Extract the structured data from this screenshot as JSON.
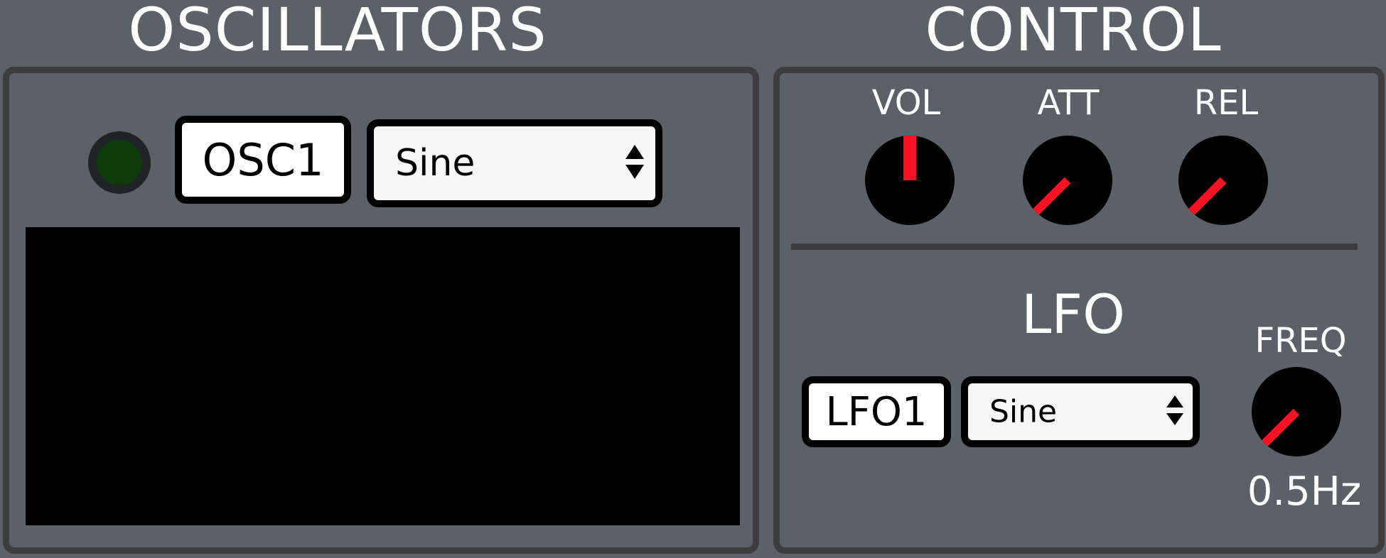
{
  "oscillators": {
    "title": "OSCILLATORS",
    "osc_button_label": "OSC1",
    "waveform_selected": "Sine",
    "led_color": "#0c3b0c"
  },
  "control": {
    "title": "CONTROL",
    "knobs": {
      "vol": {
        "label": "VOL",
        "angle_deg": 0
      },
      "att": {
        "label": "ATT",
        "angle_deg": -135
      },
      "rel": {
        "label": "REL",
        "angle_deg": -135
      }
    }
  },
  "lfo": {
    "title": "LFO",
    "lfo_button_label": "LFO1",
    "waveform_selected": "Sine",
    "freq": {
      "label": "FREQ",
      "value": "0.5Hz",
      "angle_deg": -135
    }
  },
  "colors": {
    "background": "#5c6068",
    "panel_border": "#3d3d3f",
    "knob_body": "#000000",
    "knob_indicator": "#ff1020",
    "scope": "#000000"
  },
  "icons": {
    "select_arrows": "up-down-arrows-icon"
  }
}
